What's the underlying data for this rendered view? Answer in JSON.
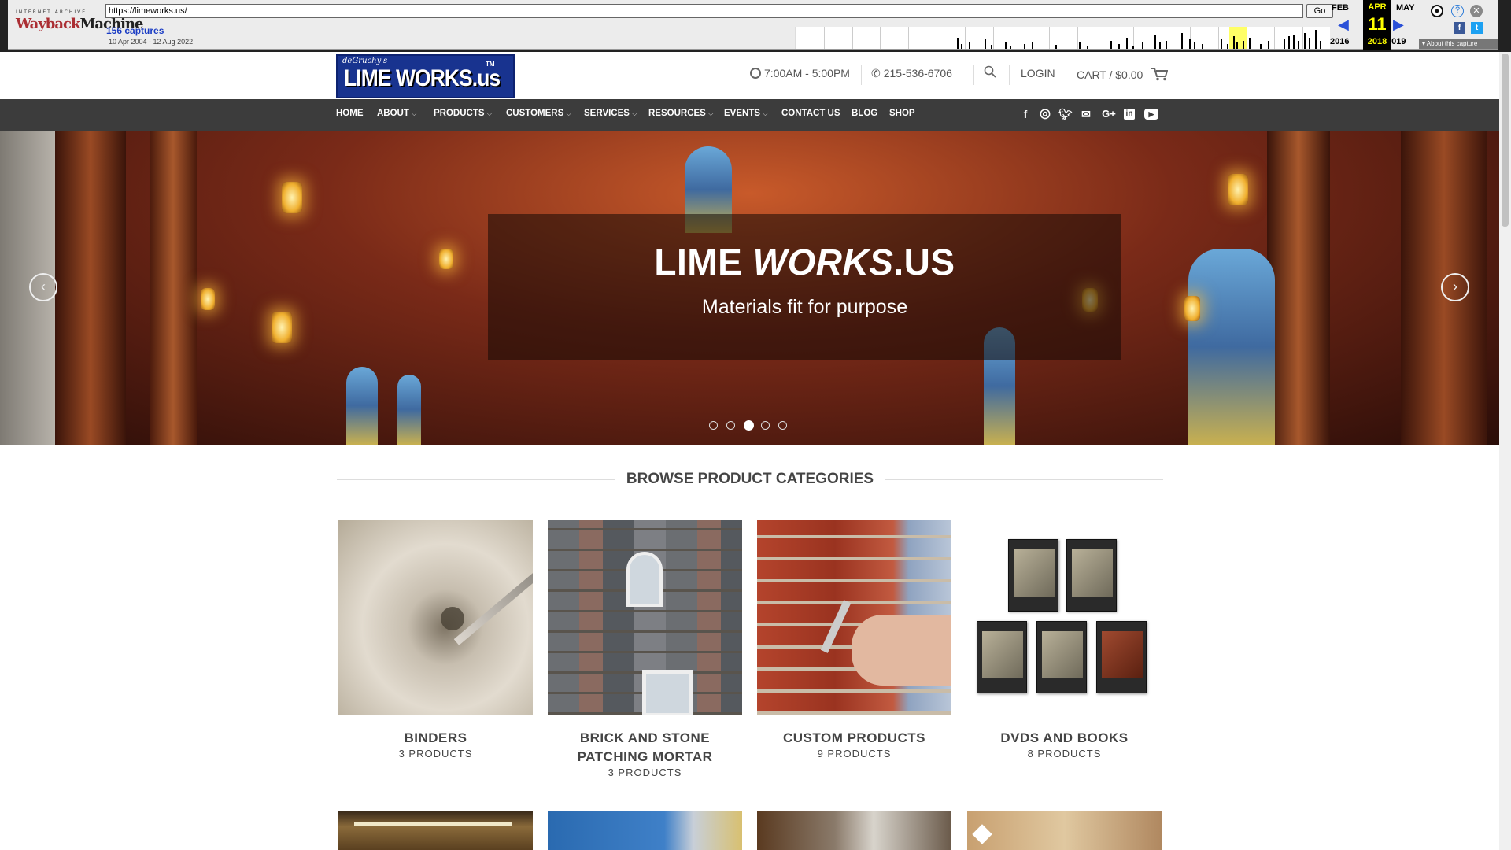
{
  "wayback": {
    "logo_top": "INTERNET ARCHIVE",
    "logo_main_a": "Wayback",
    "logo_main_b": "Machine",
    "url": "https://limeworks.us/",
    "go": "Go",
    "captures": "156 captures",
    "range": "10 Apr 2004 - 12 Aug 2022",
    "months": {
      "prev": "FEB",
      "cur": "APR",
      "next": "MAY"
    },
    "day": "11",
    "years": {
      "prev": "2016",
      "cur": "2018",
      "next": "2019"
    },
    "about": "About this capture"
  },
  "header": {
    "logo_small": "deGruchy's",
    "logo_big": "LIME  WORKS.us",
    "logo_tm": "TM",
    "hours": "7:00AM - 5:00PM",
    "phone": "215-536-6706",
    "login": "LOGIN",
    "cart": "CART / $0.00"
  },
  "nav": {
    "items": [
      {
        "label": "HOME",
        "dropdown": false
      },
      {
        "label": "ABOUT",
        "dropdown": true
      },
      {
        "label": "PRODUCTS",
        "dropdown": true
      },
      {
        "label": "CUSTOMERS",
        "dropdown": true
      },
      {
        "label": "SERVICES",
        "dropdown": true
      },
      {
        "label": "RESOURCES",
        "dropdown": true
      },
      {
        "label": "EVENTS",
        "dropdown": true
      },
      {
        "label": "CONTACT US",
        "dropdown": false
      },
      {
        "label": "BLOG",
        "dropdown": false
      },
      {
        "label": "SHOP",
        "dropdown": false
      }
    ],
    "social": [
      "facebook-icon",
      "instagram-icon",
      "twitter-icon",
      "email-icon",
      "google-plus-icon",
      "linkedin-icon",
      "youtube-icon"
    ]
  },
  "hero": {
    "title_a": "LIME",
    "title_b": "WORKS",
    "title_c": ".US",
    "subtitle": "Materials fit for purpose",
    "slides": 5,
    "active_slide": 3
  },
  "categories": {
    "heading": "BROWSE PRODUCT CATEGORIES",
    "items": [
      {
        "name": "BINDERS",
        "count": "3 PRODUCTS"
      },
      {
        "name": "BRICK AND STONE PATCHING MORTAR",
        "count": "3 PRODUCTS"
      },
      {
        "name": "CUSTOM PRODUCTS",
        "count": "9 PRODUCTS"
      },
      {
        "name": "DVDS AND BOOKS",
        "count": "8 PRODUCTS"
      }
    ]
  },
  "colors": {
    "nav_bg": "#3c3c3c",
    "logo_blue": "#18338f",
    "link_blue": "#1a3cc4"
  }
}
